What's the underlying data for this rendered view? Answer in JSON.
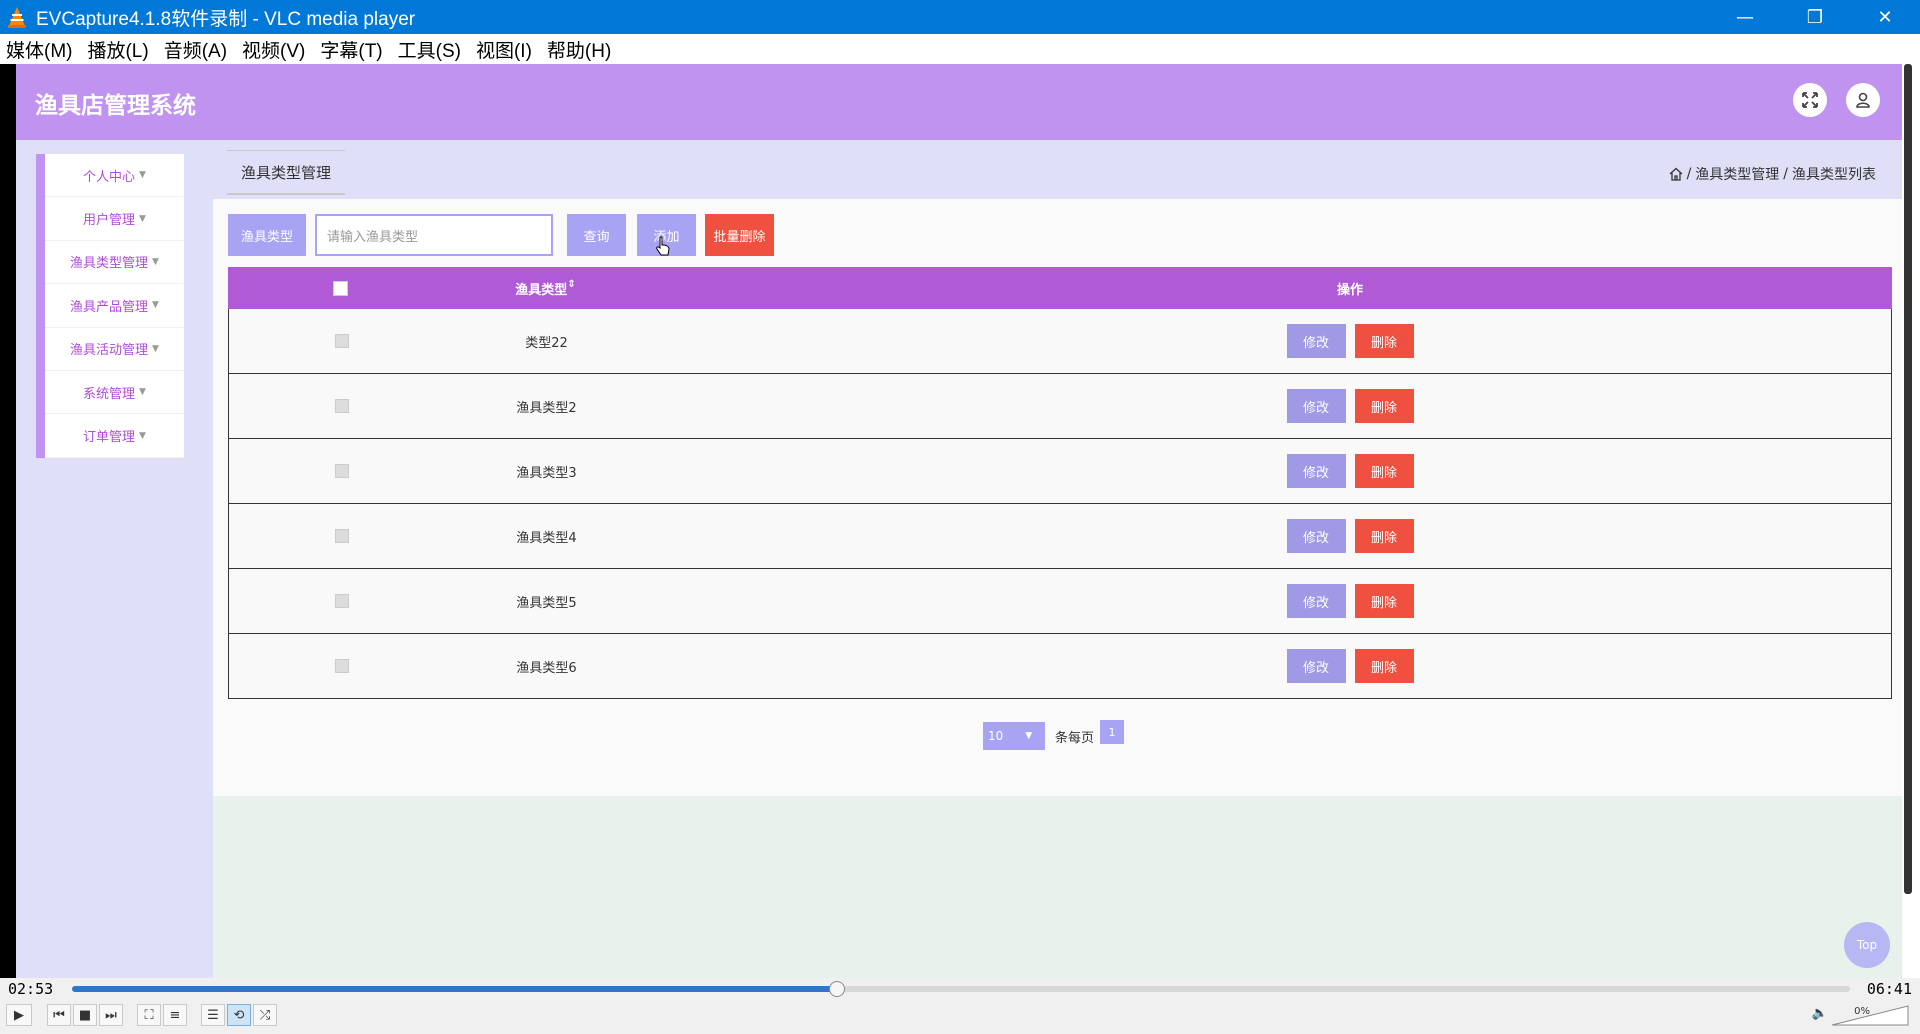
{
  "window": {
    "title": "EVCapture4.1.8软件录制 - VLC media player",
    "minimize": "—",
    "restore": "❐",
    "close": "✕"
  },
  "menu": [
    "媒体(M)",
    "播放(L)",
    "音频(A)",
    "视频(V)",
    "字幕(T)",
    "工具(S)",
    "视图(I)",
    "帮助(H)"
  ],
  "app": {
    "title": "渔具店管理系统",
    "sidebar": [
      {
        "label": "个人中心"
      },
      {
        "label": "用户管理"
      },
      {
        "label": "渔具类型管理"
      },
      {
        "label": "渔具产品管理"
      },
      {
        "label": "渔具活动管理"
      },
      {
        "label": "系统管理"
      },
      {
        "label": "订单管理"
      }
    ],
    "tab_title": "渔具类型管理",
    "breadcrumb": {
      "sep": "/",
      "level1": "渔具类型管理",
      "level2": "渔具类型列表"
    },
    "search": {
      "label": "渔具类型",
      "placeholder": "请输入渔具类型",
      "query_button": "查询",
      "add_button": "添加",
      "batch_delete_button": "批量删除"
    },
    "table": {
      "headers": {
        "name": "渔具类型",
        "ops": "操作"
      },
      "edit_label": "修改",
      "delete_label": "删除",
      "rows": [
        "类型22",
        "渔具类型2",
        "渔具类型3",
        "渔具类型4",
        "渔具类型5",
        "渔具类型6"
      ]
    },
    "pager": {
      "page_size": "10",
      "per_page_text": "条每页",
      "current_page": "1"
    },
    "top_button": "Top",
    "colors": {
      "header": "#bf93ef",
      "table_header": "#b05ad6",
      "button": "#a9a3f3",
      "danger": "#f0503f"
    }
  },
  "player": {
    "elapsed": "02:53",
    "total": "06:41",
    "progress_fraction": 0.43,
    "volume": "0%"
  }
}
